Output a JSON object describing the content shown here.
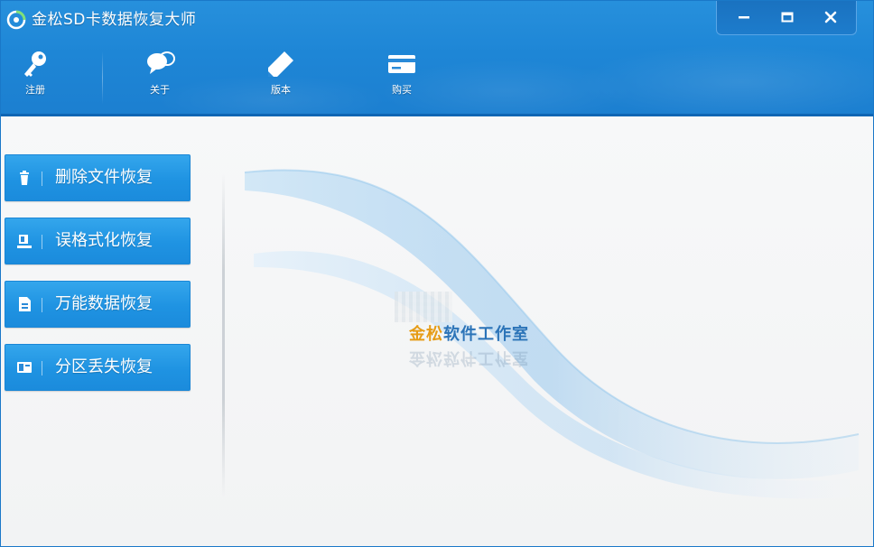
{
  "window": {
    "title": "金松SD卡数据恢复大师",
    "accent_color": "#1e86d6",
    "controls": {
      "minimize_icon": "minimize-icon",
      "maximize_icon": "maximize-icon",
      "close_icon": "close-icon"
    }
  },
  "toolbar": {
    "items": [
      {
        "label": "注册",
        "icon": "key-icon"
      },
      {
        "label": "关于",
        "icon": "speech-bubbles-icon"
      },
      {
        "label": "版本",
        "icon": "pencil-icon"
      },
      {
        "label": "购买",
        "icon": "card-icon"
      }
    ]
  },
  "sidebar": {
    "items": [
      {
        "label": "删除文件恢复",
        "icon": "trash-icon"
      },
      {
        "label": "误格式化恢复",
        "icon": "format-icon"
      },
      {
        "label": "万能数据恢复",
        "icon": "document-icon"
      },
      {
        "label": "分区丢失恢复",
        "icon": "partition-icon"
      }
    ]
  },
  "main": {
    "brand_part1": "金松",
    "brand_part2": "软件工作室",
    "brand_colors": {
      "part1": "#e69c16",
      "part2": "#2c74b8"
    }
  }
}
